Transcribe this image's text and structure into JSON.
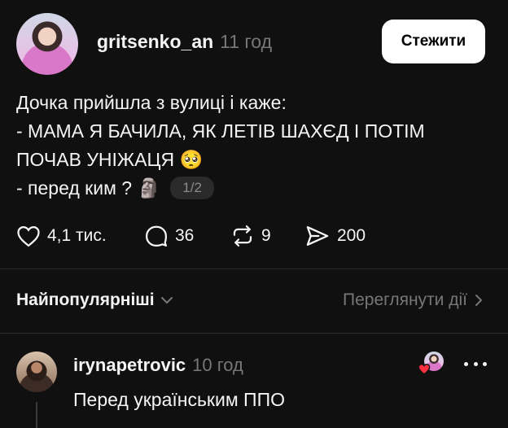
{
  "post": {
    "author": "gritsenko_an",
    "time": "11 год",
    "follow_label": "Стежити",
    "lines": [
      "Дочка прийшла з вулиці і каже:",
      "- МАМА Я БАЧИЛА, ЯК ЛЕТІВ ШАХЄД І ПОТІМ",
      "ПОЧАВ УНІЖАЦЯ 🥺",
      "- перед ким ? 🗿"
    ],
    "page_indicator": "1/2",
    "likes": "4,1 тис.",
    "comments": "36",
    "reposts": "9",
    "shares": "200"
  },
  "replies_bar": {
    "sort_label": "Найпопулярніші",
    "activity_label": "Переглянути дії"
  },
  "reply": {
    "author": "irynapetrovic",
    "time": "10 год",
    "text": "Перед українським ППО"
  },
  "colors": {
    "background": "#101010",
    "text": "#f3f5f7",
    "muted": "#777777",
    "like_heart": "#ff3040"
  }
}
